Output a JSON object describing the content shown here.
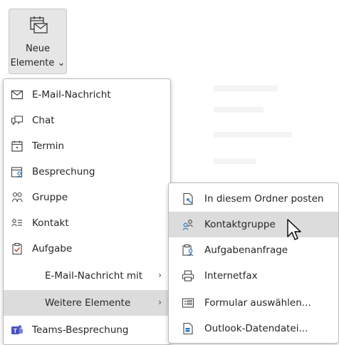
{
  "ribbon": {
    "label_line1": "Neue",
    "label_line2": "Elemente ⌄"
  },
  "menu": {
    "items": [
      {
        "label": "E-Mail-Nachricht",
        "icon": "envelope-icon"
      },
      {
        "label": "Chat",
        "icon": "chat-icon"
      },
      {
        "label": "Termin",
        "icon": "calendar-icon"
      },
      {
        "label": "Besprechung",
        "icon": "meeting-icon"
      },
      {
        "label": "Gruppe",
        "icon": "group-icon"
      },
      {
        "label": "Kontakt",
        "icon": "contact-icon"
      },
      {
        "label": "Aufgabe",
        "icon": "task-icon"
      },
      {
        "label": "E-Mail-Nachricht mit",
        "arrow": "›"
      },
      {
        "label": "Weitere Elemente",
        "arrow": "›"
      },
      {
        "label": "Teams-Besprechung",
        "icon": "teams-icon"
      }
    ]
  },
  "submenu": {
    "items": [
      {
        "label": "In diesem Ordner posten",
        "icon": "post-icon"
      },
      {
        "label": "Kontaktgruppe",
        "icon": "contact-group-icon"
      },
      {
        "label": "Aufgabenanfrage",
        "icon": "task-request-icon"
      },
      {
        "label": "Internetfax",
        "icon": "fax-icon"
      },
      {
        "label": "Formular auswählen...",
        "icon": "form-icon"
      },
      {
        "label": "Outlook-Datendatei...",
        "icon": "data-file-icon"
      }
    ]
  }
}
